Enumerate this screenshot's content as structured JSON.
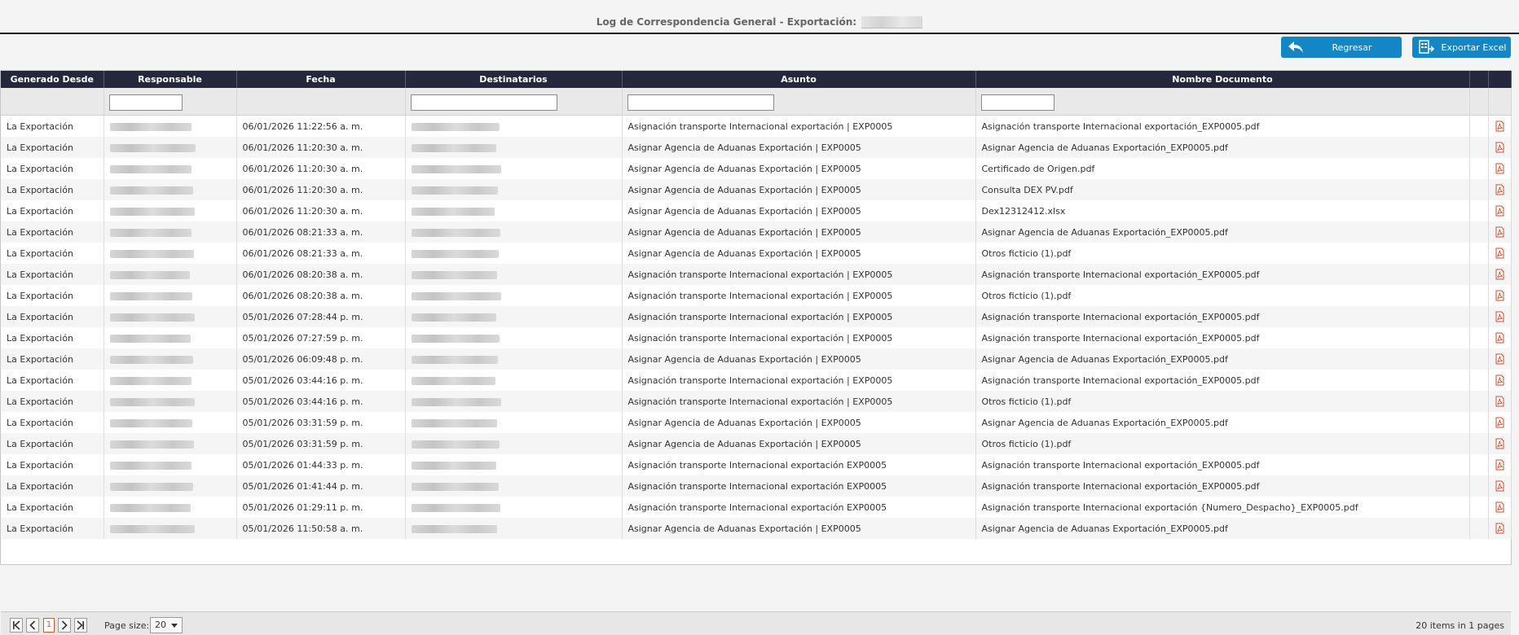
{
  "page": {
    "title": "Log de Correspondencia General - Exportación:"
  },
  "buttons": {
    "back_label": "Regresar",
    "export_label": "Exportar Excel"
  },
  "colors": {
    "header_bg": "#25283d",
    "button_bg": "#1387c6",
    "pdf_icon": "#d24a2a",
    "current_page": "#d05b2b"
  },
  "table": {
    "columns": [
      "Generado Desde",
      "Responsable",
      "Fecha",
      "Destinatarios",
      "Asunto",
      "Nombre Documento"
    ],
    "rows": [
      {
        "origen": "La Exportación",
        "fecha": "06/01/2026 11:22:56 a. m.",
        "asunto": "Asignación transporte Internacional exportación | EXP0005",
        "documento": "Asignación transporte Internacional exportación_EXP0005.pdf"
      },
      {
        "origen": "La Exportación",
        "fecha": "06/01/2026 11:20:30 a. m.",
        "asunto": "Asignar Agencia de Aduanas Exportación | EXP0005",
        "documento": "Asignar Agencia de Aduanas Exportación_EXP0005.pdf"
      },
      {
        "origen": "La Exportación",
        "fecha": "06/01/2026 11:20:30 a. m.",
        "asunto": "Asignar Agencia de Aduanas Exportación | EXP0005",
        "documento": "Certificado de Origen.pdf"
      },
      {
        "origen": "La Exportación",
        "fecha": "06/01/2026 11:20:30 a. m.",
        "asunto": "Asignar Agencia de Aduanas Exportación | EXP0005",
        "documento": "Consulta DEX PV.pdf"
      },
      {
        "origen": "La Exportación",
        "fecha": "06/01/2026 11:20:30 a. m.",
        "asunto": "Asignar Agencia de Aduanas Exportación | EXP0005",
        "documento": "Dex12312412.xlsx"
      },
      {
        "origen": "La Exportación",
        "fecha": "06/01/2026 08:21:33 a. m.",
        "asunto": "Asignar Agencia de Aduanas Exportación | EXP0005",
        "documento": "Asignar Agencia de Aduanas Exportación_EXP0005.pdf"
      },
      {
        "origen": "La Exportación",
        "fecha": "06/01/2026 08:21:33 a. m.",
        "asunto": "Asignar Agencia de Aduanas Exportación | EXP0005",
        "documento": "Otros ficticio (1).pdf"
      },
      {
        "origen": "La Exportación",
        "fecha": "06/01/2026 08:20:38 a. m.",
        "asunto": "Asignación transporte Internacional exportación | EXP0005",
        "documento": "Asignación transporte Internacional exportación_EXP0005.pdf"
      },
      {
        "origen": "La Exportación",
        "fecha": "06/01/2026 08:20:38 a. m.",
        "asunto": "Asignación transporte Internacional exportación | EXP0005",
        "documento": "Otros ficticio (1).pdf"
      },
      {
        "origen": "La Exportación",
        "fecha": "05/01/2026 07:28:44 p. m.",
        "asunto": "Asignación transporte Internacional exportación | EXP0005",
        "documento": "Asignación transporte Internacional exportación_EXP0005.pdf"
      },
      {
        "origen": "La Exportación",
        "fecha": "05/01/2026 07:27:59 p. m.",
        "asunto": "Asignación transporte Internacional exportación | EXP0005",
        "documento": "Asignación transporte Internacional exportación_EXP0005.pdf"
      },
      {
        "origen": "La Exportación",
        "fecha": "05/01/2026 06:09:48 p. m.",
        "asunto": "Asignar Agencia de Aduanas Exportación | EXP0005",
        "documento": "Asignar Agencia de Aduanas Exportación_EXP0005.pdf"
      },
      {
        "origen": "La Exportación",
        "fecha": "05/01/2026 03:44:16 p. m.",
        "asunto": "Asignación transporte Internacional exportación | EXP0005",
        "documento": "Asignación transporte Internacional exportación_EXP0005.pdf"
      },
      {
        "origen": "La Exportación",
        "fecha": "05/01/2026 03:44:16 p. m.",
        "asunto": "Asignación transporte Internacional exportación | EXP0005",
        "documento": "Otros ficticio (1).pdf"
      },
      {
        "origen": "La Exportación",
        "fecha": "05/01/2026 03:31:59 p. m.",
        "asunto": "Asignar Agencia de Aduanas Exportación | EXP0005",
        "documento": "Asignar Agencia de Aduanas Exportación_EXP0005.pdf"
      },
      {
        "origen": "La Exportación",
        "fecha": "05/01/2026 03:31:59 p. m.",
        "asunto": "Asignar Agencia de Aduanas Exportación | EXP0005",
        "documento": "Otros ficticio (1).pdf"
      },
      {
        "origen": "La Exportación",
        "fecha": "05/01/2026 01:44:33 p. m.",
        "asunto": "Asignación transporte Internacional exportación EXP0005",
        "documento": "Asignación transporte Internacional exportación_EXP0005.pdf"
      },
      {
        "origen": "La Exportación",
        "fecha": "05/01/2026 01:41:44 p. m.",
        "asunto": "Asignación transporte Internacional exportación EXP0005",
        "documento": "Asignación transporte Internacional exportación_EXP0005.pdf"
      },
      {
        "origen": "La Exportación",
        "fecha": "05/01/2026 01:29:11 p. m.",
        "asunto": "Asignación transporte Internacional exportación EXP0005",
        "documento": "Asignación transporte Internacional exportación {Numero_Despacho}_EXP0005.pdf"
      },
      {
        "origen": "La Exportación",
        "fecha": "05/01/2026 11:50:58 a. m.",
        "asunto": "Asignar Agencia de Aduanas Exportación | EXP0005",
        "documento": "Asignar Agencia de Aduanas Exportación_EXP0005.pdf"
      }
    ]
  },
  "pager": {
    "current_page": "1",
    "page_size_label": "Page size:",
    "page_size_value": "20",
    "info": "20 items in 1 pages"
  }
}
